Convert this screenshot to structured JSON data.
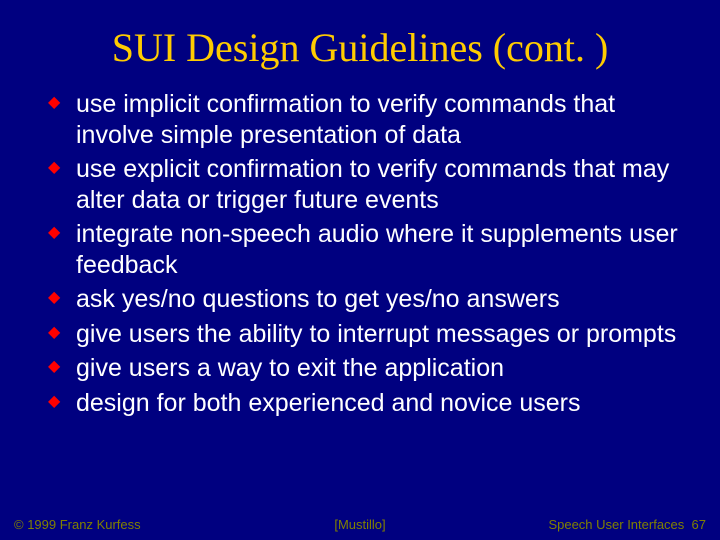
{
  "title": "SUI Design Guidelines (cont. )",
  "bullets": [
    "use implicit confirmation to verify commands that involve simple presentation of data",
    "use explicit confirmation to verify commands that may alter data or trigger future events",
    "integrate non-speech audio where it supplements user feedback",
    "ask yes/no questions to get yes/no answers",
    "give users the ability to interrupt messages or prompts",
    "give users a way to exit the application",
    "design for both experienced and novice users"
  ],
  "footer": {
    "left": "© 1999 Franz Kurfess",
    "mid": "[Mustillo]",
    "right_label": "Speech User Interfaces",
    "right_page": "67"
  }
}
